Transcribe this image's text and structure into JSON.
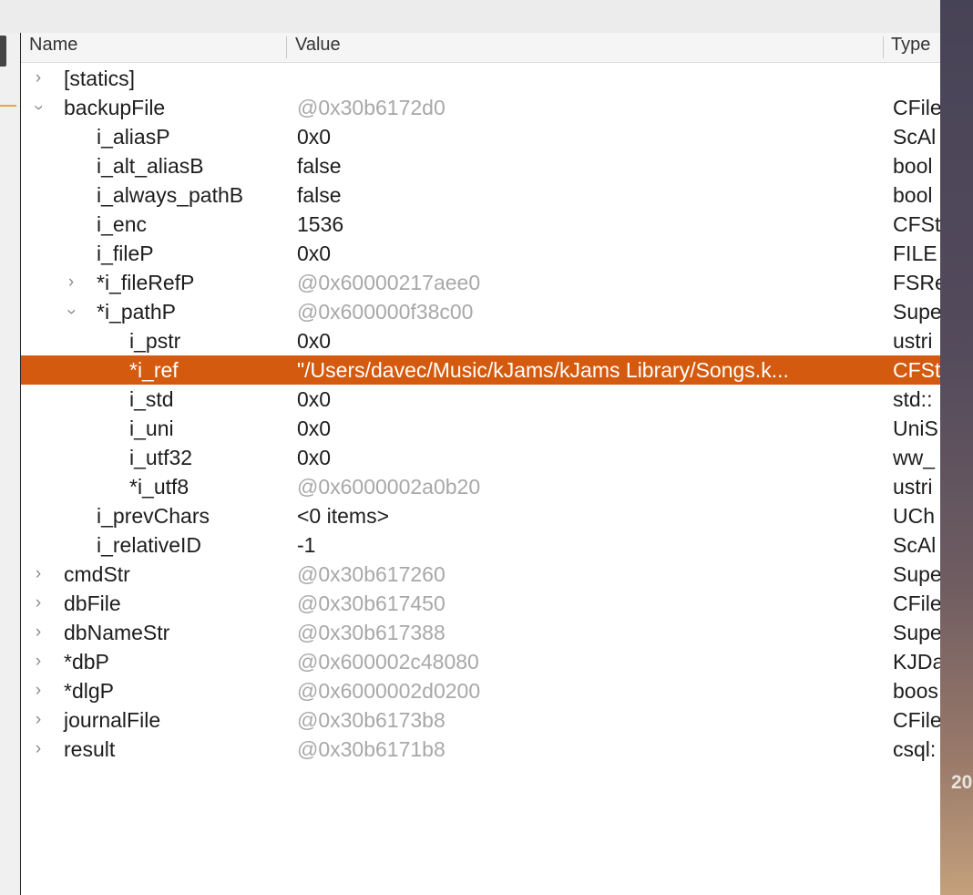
{
  "columns": {
    "name": "Name",
    "value": "Value",
    "type": "Type"
  },
  "desktop_text": "20",
  "rows": [
    {
      "name": "[statics]",
      "value": "",
      "type": "",
      "level": 0,
      "expand": "collapsed",
      "dim": false,
      "selected": false
    },
    {
      "name": "backupFile",
      "value": "@0x30b6172d0",
      "type": "CFile",
      "level": 0,
      "expand": "expanded",
      "dim": true,
      "selected": false
    },
    {
      "name": "i_aliasP",
      "value": "0x0",
      "type": "ScAl",
      "level": 1,
      "expand": "none",
      "dim": false,
      "selected": false
    },
    {
      "name": "i_alt_aliasB",
      "value": "false",
      "type": "bool",
      "level": 1,
      "expand": "none",
      "dim": false,
      "selected": false
    },
    {
      "name": "i_always_pathB",
      "value": "false",
      "type": "bool",
      "level": 1,
      "expand": "none",
      "dim": false,
      "selected": false
    },
    {
      "name": "i_enc",
      "value": "1536",
      "type": "CFSt",
      "level": 1,
      "expand": "none",
      "dim": false,
      "selected": false
    },
    {
      "name": "i_fileP",
      "value": "0x0",
      "type": "FILE",
      "level": 1,
      "expand": "none",
      "dim": false,
      "selected": false
    },
    {
      "name": "*i_fileRefP",
      "value": "@0x60000217aee0",
      "type": "FSRe",
      "level": 1,
      "expand": "collapsed",
      "dim": true,
      "selected": false
    },
    {
      "name": "*i_pathP",
      "value": "@0x600000f38c00",
      "type": "Supe",
      "level": 1,
      "expand": "expanded",
      "dim": true,
      "selected": false
    },
    {
      "name": "i_pstr",
      "value": "0x0",
      "type": "ustri",
      "level": 2,
      "expand": "none",
      "dim": false,
      "selected": false
    },
    {
      "name": "*i_ref",
      "value": "\"/Users/davec/Music/kJams/kJams Library/Songs.k...",
      "type": "CFSt",
      "level": 2,
      "expand": "none",
      "dim": false,
      "selected": true
    },
    {
      "name": "i_std",
      "value": "0x0",
      "type": "std::",
      "level": 2,
      "expand": "none",
      "dim": false,
      "selected": false
    },
    {
      "name": "i_uni",
      "value": "0x0",
      "type": "UniS",
      "level": 2,
      "expand": "none",
      "dim": false,
      "selected": false
    },
    {
      "name": "i_utf32",
      "value": "0x0",
      "type": "ww_",
      "level": 2,
      "expand": "none",
      "dim": false,
      "selected": false
    },
    {
      "name": "*i_utf8",
      "value": "@0x6000002a0b20",
      "type": "ustri",
      "level": 2,
      "expand": "none",
      "dim": true,
      "selected": false
    },
    {
      "name": "i_prevChars",
      "value": "<0 items>",
      "type": "UCh",
      "level": 1,
      "expand": "none",
      "dim": false,
      "selected": false
    },
    {
      "name": "i_relativeID",
      "value": "-1",
      "type": "ScAl",
      "level": 1,
      "expand": "none",
      "dim": false,
      "selected": false
    },
    {
      "name": "cmdStr",
      "value": "@0x30b617260",
      "type": "Supe",
      "level": 0,
      "expand": "collapsed",
      "dim": true,
      "selected": false
    },
    {
      "name": "dbFile",
      "value": "@0x30b617450",
      "type": "CFile",
      "level": 0,
      "expand": "collapsed",
      "dim": true,
      "selected": false
    },
    {
      "name": "dbNameStr",
      "value": "@0x30b617388",
      "type": "Supe",
      "level": 0,
      "expand": "collapsed",
      "dim": true,
      "selected": false
    },
    {
      "name": "*dbP",
      "value": "@0x600002c48080",
      "type": "KJDa",
      "level": 0,
      "expand": "collapsed",
      "dim": true,
      "selected": false
    },
    {
      "name": "*dlgP",
      "value": "@0x6000002d0200",
      "type": "boos",
      "level": 0,
      "expand": "collapsed",
      "dim": true,
      "selected": false
    },
    {
      "name": "journalFile",
      "value": "@0x30b6173b8",
      "type": "CFile",
      "level": 0,
      "expand": "collapsed",
      "dim": true,
      "selected": false
    },
    {
      "name": "result",
      "value": "@0x30b6171b8",
      "type": "csql:",
      "level": 0,
      "expand": "collapsed",
      "dim": true,
      "selected": false
    }
  ]
}
